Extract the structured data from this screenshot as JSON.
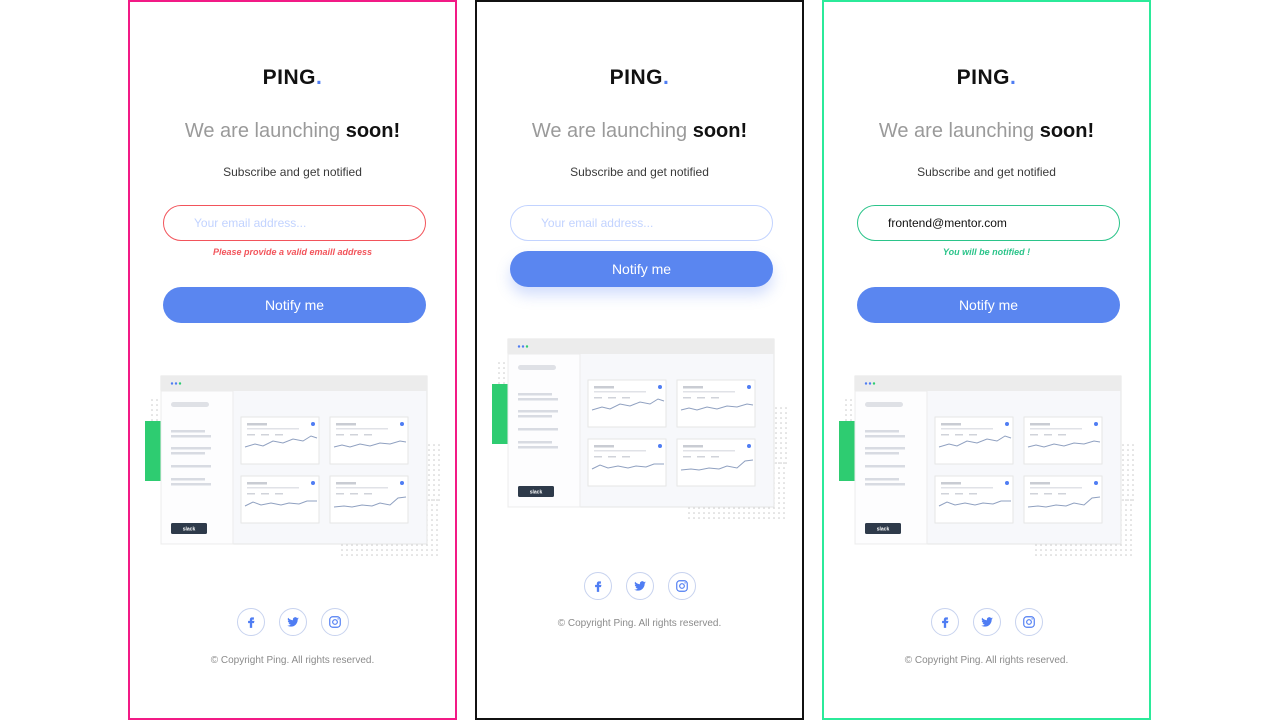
{
  "logo": {
    "text": "PING",
    "dot": "."
  },
  "headline": {
    "light": "We are launching ",
    "bold": "soon!"
  },
  "subtitle": "Subscribe and get notified",
  "email": {
    "placeholder": "Your email address...",
    "success_value": "frontend@mentor.com"
  },
  "messages": {
    "error": "Please provide a valid emaill address",
    "success": "You will be notified !"
  },
  "button": {
    "label": "Notify me"
  },
  "dashboard": {
    "badge": "slack"
  },
  "socials": [
    "facebook-icon",
    "twitter-icon",
    "instagram-icon"
  ],
  "footer": {
    "copyright": "© Copyright Ping. All rights reserved."
  },
  "colors": {
    "accent": "#4f7df3",
    "error": "#f2545b",
    "success": "#2bc48a",
    "error_border": "#f21a86",
    "success_border": "#2bea9a"
  }
}
